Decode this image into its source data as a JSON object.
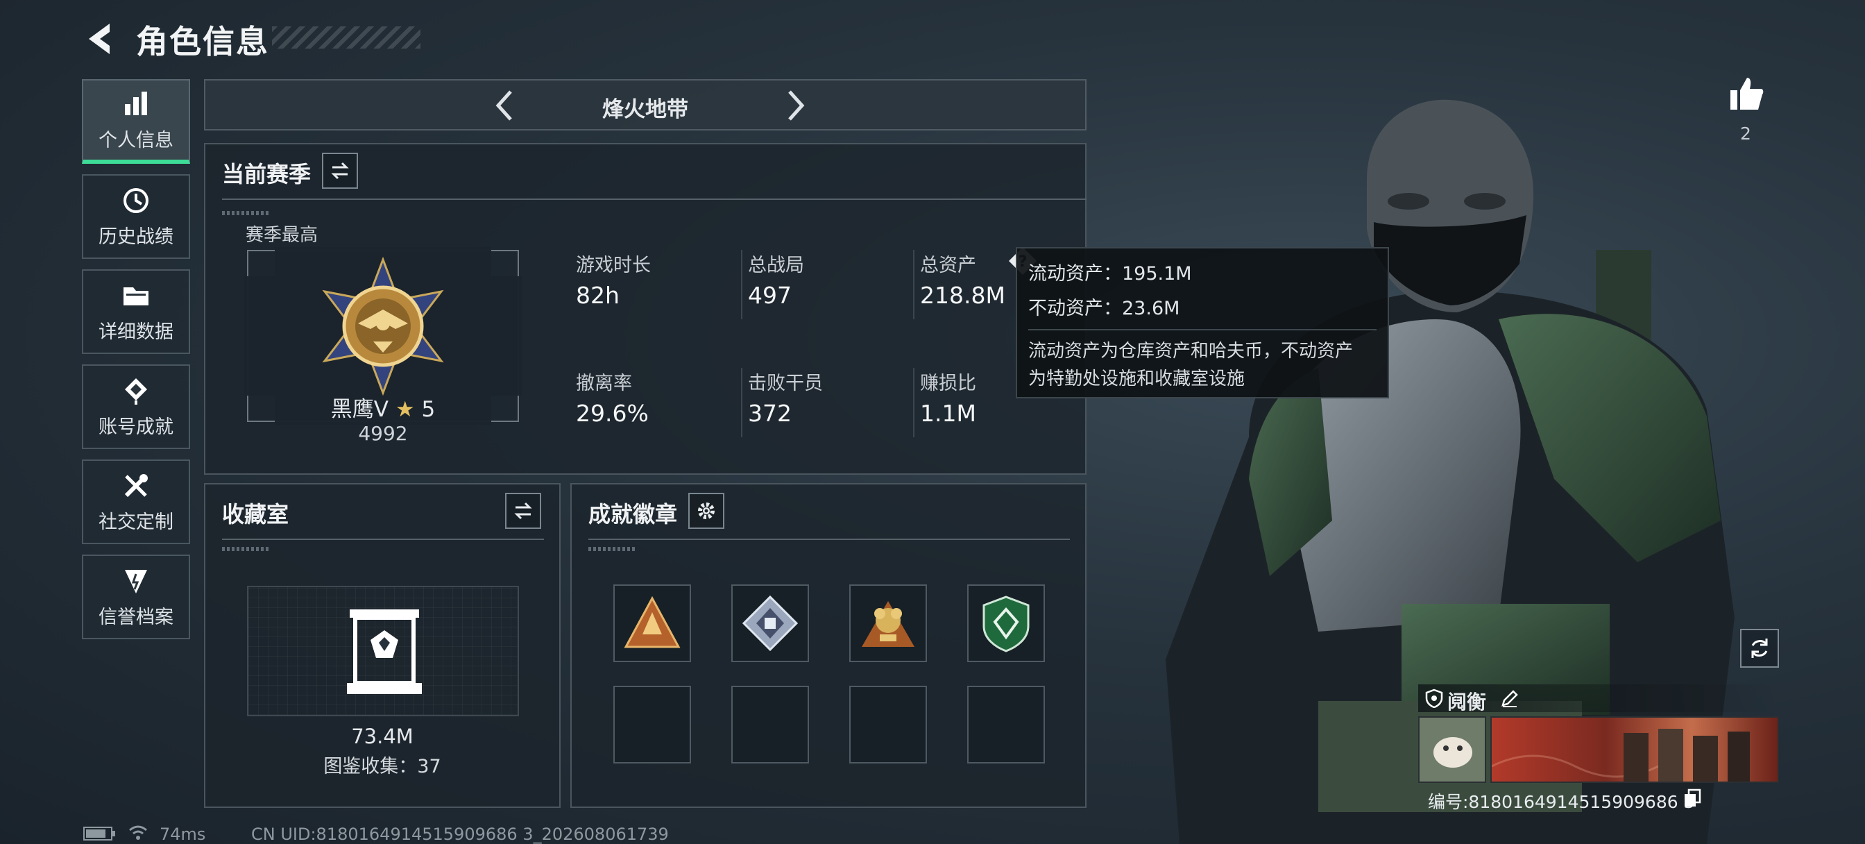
{
  "header": {
    "title": "角色信息"
  },
  "nav": {
    "items": [
      {
        "label": "个人信息",
        "icon": "bar-chart-icon",
        "active": true
      },
      {
        "label": "历史战绩",
        "icon": "history-clock-icon",
        "active": false
      },
      {
        "label": "详细数据",
        "icon": "folder-icon",
        "active": false
      },
      {
        "label": "账号成就",
        "icon": "achievement-icon",
        "active": false
      },
      {
        "label": "社交定制",
        "icon": "tools-icon",
        "active": false
      },
      {
        "label": "信誉档案",
        "icon": "credit-shield-icon",
        "active": false
      }
    ]
  },
  "mode": {
    "title": "烽火地带"
  },
  "season": {
    "title": "当前赛季",
    "best_label": "赛季最高",
    "rank_name": "黑鹰V",
    "rank_stars": "5",
    "rank_score": "4992",
    "stats": [
      {
        "label": "游戏时长",
        "value": "82h"
      },
      {
        "label": "总战局",
        "value": "497"
      },
      {
        "label": "总资产",
        "value": "218.8M"
      },
      {
        "label": "撤离率",
        "value": "29.6%"
      },
      {
        "label": "击败干员",
        "value": "372"
      },
      {
        "label": "赚损比",
        "value": "1.1M"
      }
    ]
  },
  "tooltip": {
    "liquid": "流动资产：195.1M",
    "fixed": "不动资产：23.6M",
    "desc_line1": "流动资产为仓库资产和哈夫币，不动资产",
    "desc_line2": "为特勤处设施和收藏室设施"
  },
  "collection": {
    "title": "收藏室",
    "value": "73.4M",
    "count": "图鉴收集：37"
  },
  "badges": {
    "title": "成就徽章",
    "slots": [
      "triangle-badge-icon",
      "diamond-badge-icon",
      "gold-badge-icon",
      "green-shield-badge-icon",
      "",
      "",
      "",
      ""
    ]
  },
  "footer": {
    "ping": "74ms",
    "uid": "CN UID:8180164914515909686 3_202608061739"
  },
  "profile": {
    "likes": "2",
    "name": "阋衡",
    "player_id": "编号:8180164914515909686 3"
  },
  "colors": {
    "accent": "#3ddc97",
    "panel": "#1c242c"
  }
}
